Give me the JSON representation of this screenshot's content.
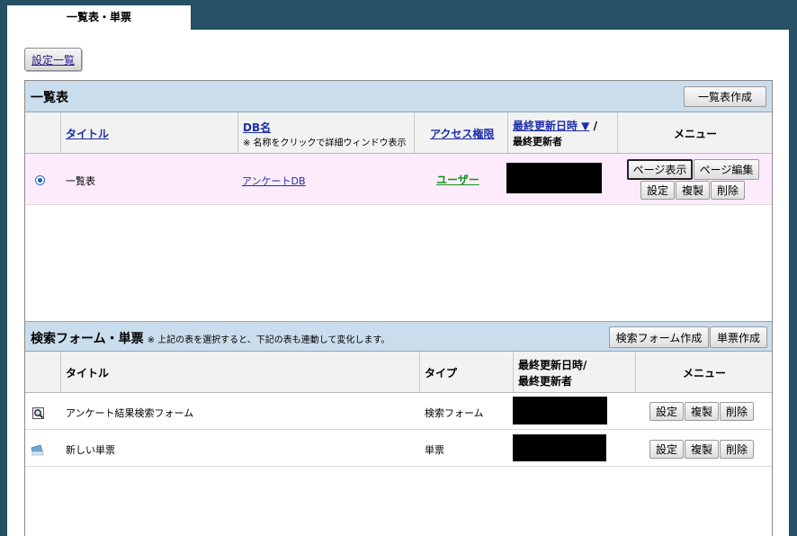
{
  "tab": {
    "label": "一覧表・単票"
  },
  "toolbar": {
    "settings_list": "設定一覧"
  },
  "list_section": {
    "title": "一覧表",
    "create_button": "一覧表作成",
    "columns": {
      "title": "タイトル",
      "db_name": "DB名",
      "db_note": "※ 名称をクリックで詳細ウィンドウ表示",
      "access": "アクセス権限",
      "updated": "最終更新日時 ▼",
      "updated_sep": " /",
      "updater": "最終更新者",
      "menu": "メニュー"
    },
    "rows": [
      {
        "title": "一覧表",
        "db": "アンケートDB",
        "access": "ユーザー",
        "buttons": {
          "page_view": "ページ表示",
          "page_edit": "ページ編集",
          "settings": "設定",
          "copy": "複製",
          "delete": "削除"
        }
      }
    ]
  },
  "form_section": {
    "title": "検索フォーム・単票",
    "note": "※ 上記の表を選択すると、下記の表も連動して変化します。",
    "create_search_button": "検索フォーム作成",
    "create_single_button": "単票作成",
    "columns": {
      "title": "タイトル",
      "type": "タイプ",
      "updated": "最終更新日時/",
      "updater": "最終更新者",
      "menu": "メニュー"
    },
    "rows": [
      {
        "icon": "magnifier-icon",
        "title": "アンケート結果検索フォーム",
        "type": "検索フォーム",
        "buttons": {
          "settings": "設定",
          "copy": "複製",
          "delete": "削除"
        }
      },
      {
        "icon": "card-icon",
        "title": "新しい単票",
        "type": "単票",
        "buttons": {
          "settings": "設定",
          "copy": "複製",
          "delete": "削除"
        }
      }
    ]
  },
  "colors": {
    "band": "#cadded",
    "selected_row": "#fdebfc",
    "access_link": "#16921e",
    "frame": "#265063"
  }
}
